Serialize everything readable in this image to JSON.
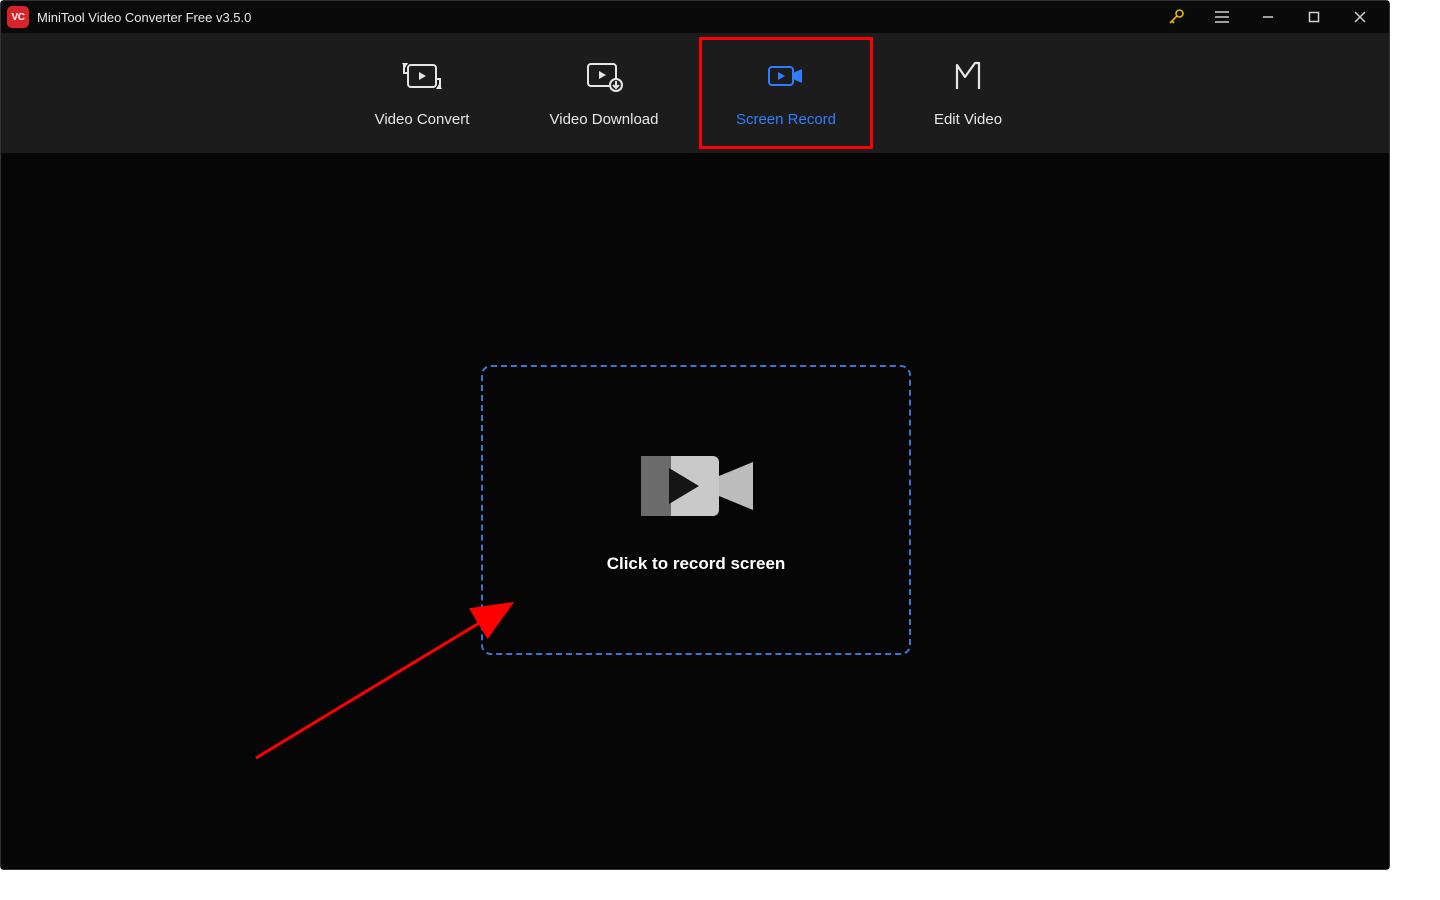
{
  "app": {
    "title": "MiniTool Video Converter Free v3.5.0",
    "logo_text": "VC"
  },
  "tabs": {
    "convert": "Video Convert",
    "download": "Video Download",
    "record": "Screen Record",
    "edit": "Edit Video"
  },
  "main": {
    "record_cta": "Click to record screen"
  }
}
